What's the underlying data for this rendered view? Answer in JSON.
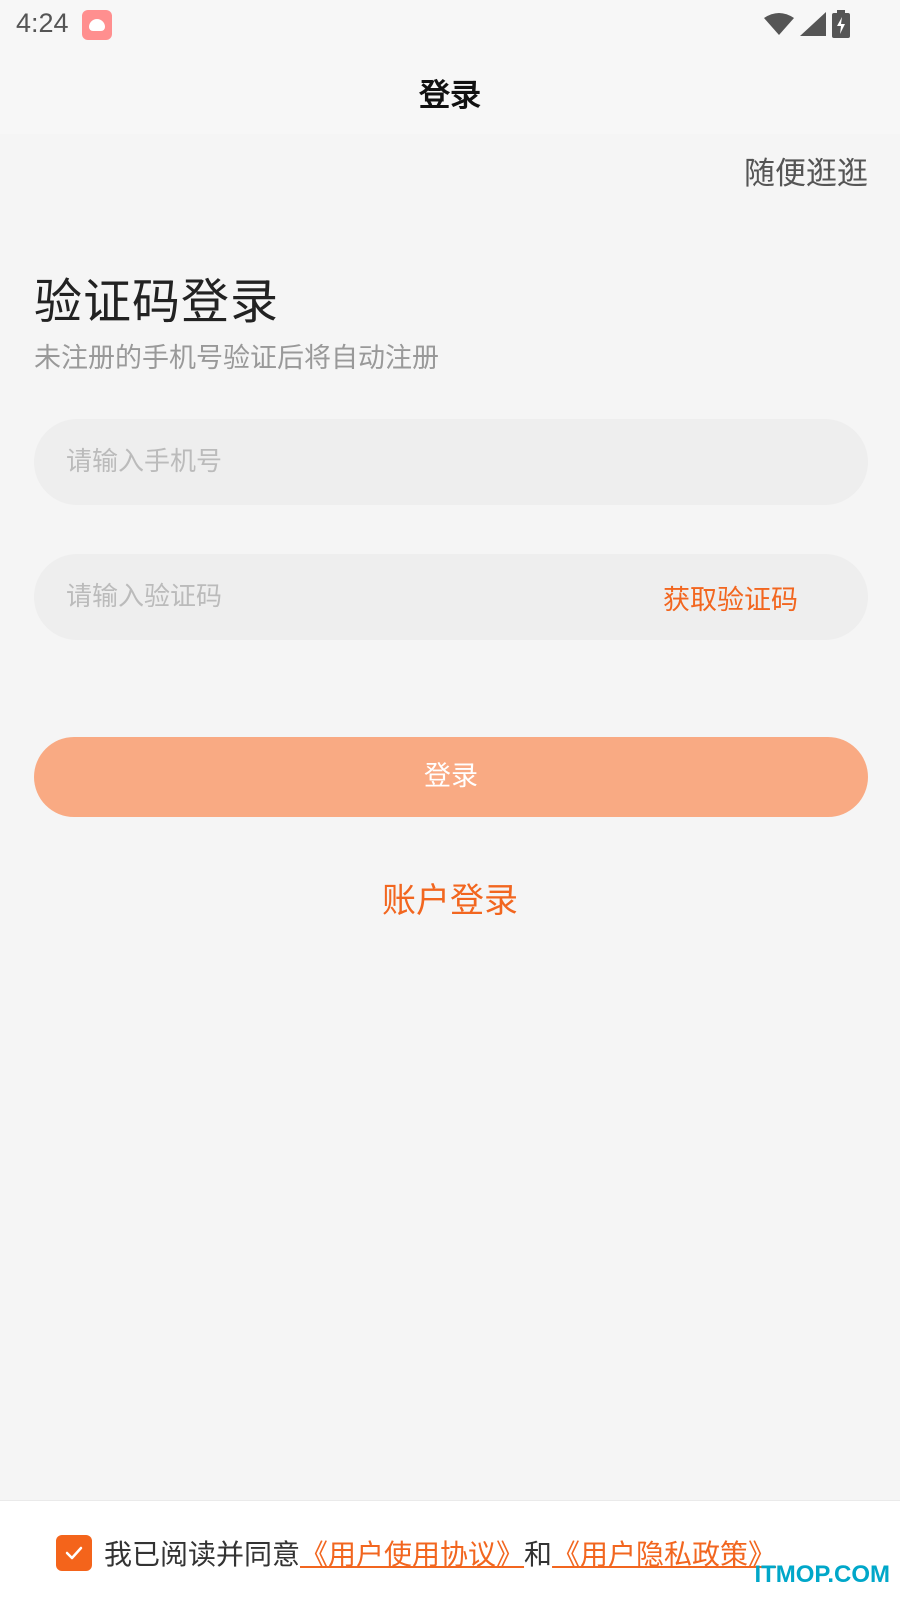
{
  "status_bar": {
    "time": "4:24"
  },
  "nav": {
    "title": "登录"
  },
  "browse_link": "随便逛逛",
  "main": {
    "title": "验证码登录",
    "subtitle": "未注册的手机号验证后将自动注册",
    "phone_input": {
      "placeholder": "请输入手机号",
      "value": ""
    },
    "code_input": {
      "placeholder": "请输入验证码",
      "value": ""
    },
    "get_code_label": "获取验证码",
    "login_label": "登录",
    "account_login_label": "账户登录"
  },
  "footer": {
    "agree_prefix": "我已阅读并同意",
    "user_agreement": "《用户使用协议》",
    "conjunction": "和",
    "privacy_policy": "《用户隐私政策》",
    "checked": true
  },
  "watermark": "ITMOP.COM",
  "colors": {
    "accent": "#f2661f",
    "login_button": "#f9aa83",
    "background": "#f5f5f5"
  }
}
